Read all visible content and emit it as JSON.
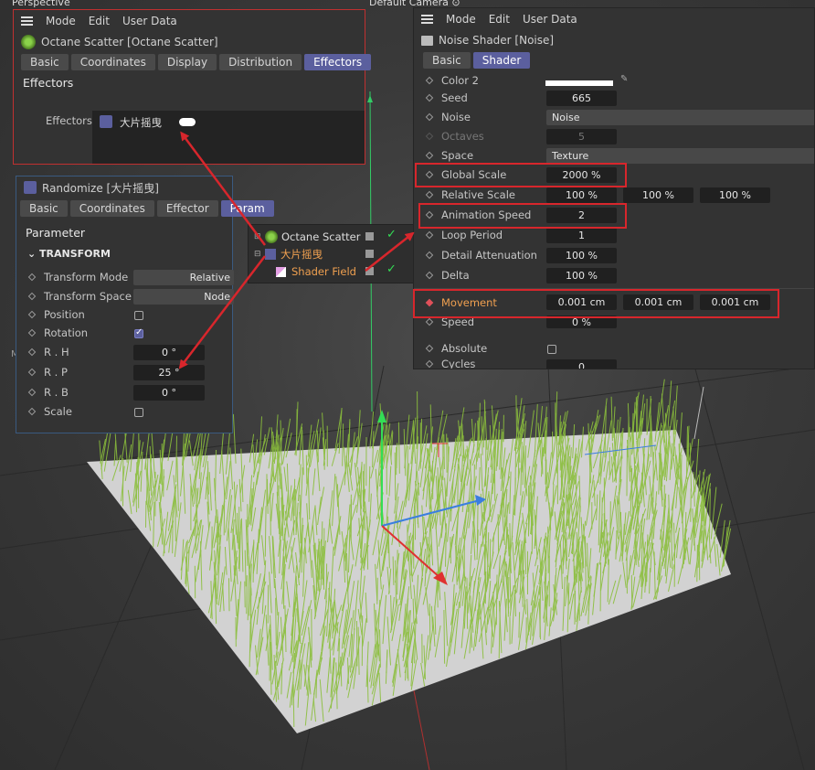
{
  "viewport": {
    "left_label": "Perspective",
    "camera_label": "Default Camera ⊙"
  },
  "octane_panel": {
    "menu": [
      "Mode",
      "Edit",
      "User Data"
    ],
    "title": "Octane Scatter [Octane Scatter]",
    "tabs": [
      "Basic",
      "Coordinates",
      "Display",
      "Distribution",
      "Effectors"
    ],
    "active_tab": "Effectors",
    "section": "Effectors",
    "effectors_label": "Effectors",
    "effector_item": "大片摇曳"
  },
  "randomize_panel": {
    "title": "Randomize [大片摇曳]",
    "tabs": [
      "Basic",
      "Coordinates",
      "Effector",
      "Param"
    ],
    "active_tab": "Param",
    "section": "Parameter",
    "group": "TRANSFORM",
    "rows": [
      {
        "label": "Transform Mode",
        "value": "Relative"
      },
      {
        "label": "Transform Space",
        "value": "Node"
      },
      {
        "label": "Position",
        "checked": false
      },
      {
        "label": "Rotation",
        "checked": true
      },
      {
        "label": "R . H",
        "value": "0 °"
      },
      {
        "label": "R . P",
        "value": "25 °"
      },
      {
        "label": "R . B",
        "value": "0 °"
      },
      {
        "label": "Scale",
        "checked": false
      }
    ]
  },
  "object_tree": {
    "items": [
      {
        "name": "Octane Scatter"
      },
      {
        "name": "大片摇曳"
      },
      {
        "name": "Shader Field"
      }
    ]
  },
  "noise_panel": {
    "menu": [
      "Mode",
      "Edit",
      "User Data"
    ],
    "title": "Noise Shader [Noise]",
    "tabs": [
      "Basic",
      "Shader"
    ],
    "active_tab": "Shader",
    "rows": {
      "color2": "Color 2",
      "seed": {
        "label": "Seed",
        "value": "665"
      },
      "noise": {
        "label": "Noise",
        "value": "Noise"
      },
      "octaves": {
        "label": "Octaves",
        "value": "5"
      },
      "space": {
        "label": "Space",
        "value": "Texture"
      },
      "global_scale": {
        "label": "Global Scale",
        "value": "2000 %"
      },
      "relative_scale": {
        "label": "Relative Scale",
        "values": [
          "100 %",
          "100 %",
          "100 %"
        ]
      },
      "animation_speed": {
        "label": "Animation Speed",
        "value": "2"
      },
      "loop_period": {
        "label": "Loop Period",
        "value": "1"
      },
      "detail_attenuation": {
        "label": "Detail Attenuation",
        "value": "100 %"
      },
      "delta": {
        "label": "Delta",
        "value": "100 %"
      },
      "movement": {
        "label": "Movement",
        "values": [
          "0.001 cm",
          "0.001 cm",
          "0.001 cm"
        ]
      },
      "speed": {
        "label": "Speed",
        "value": "0 %"
      },
      "absolute": {
        "label": "Absolute"
      },
      "cycles": {
        "label": "Cycles",
        "value": "0"
      }
    }
  },
  "colors": {
    "accent": "#5b5f9e",
    "annotation": "#d8262c",
    "grass": "#8bbf3c",
    "orange_label": "#f0a050"
  }
}
